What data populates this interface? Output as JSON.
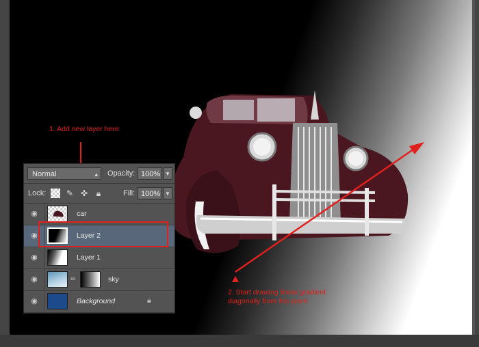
{
  "layers_panel": {
    "blend_mode": "Normal",
    "opacity_label": "Opacity:",
    "opacity_value": "100%",
    "lock_label": "Lock:",
    "fill_label": "Fill:",
    "fill_value": "100%",
    "layers": [
      {
        "name": "car",
        "italic": false,
        "selected": false,
        "thumb": "transparent-car",
        "visible": true
      },
      {
        "name": "Layer 2",
        "italic": false,
        "selected": true,
        "thumb": "black-white-gradient",
        "visible": true
      },
      {
        "name": "Layer 1",
        "italic": false,
        "selected": false,
        "thumb": "white-gradient",
        "visible": true
      },
      {
        "name": "sky",
        "italic": false,
        "selected": false,
        "thumb": "sky-with-mask",
        "visible": true
      },
      {
        "name": "Background",
        "italic": true,
        "selected": false,
        "thumb": "solid-blue",
        "visible": true,
        "locked": true
      }
    ]
  },
  "annotations": {
    "step1": "1. Add new layer here",
    "step2_line1": "2. Start drawing linear gradient",
    "step2_line2": "diagonally from this point"
  },
  "colors": {
    "annotation_red": "#e0201c",
    "panel_bg": "#535353",
    "selected_layer_bg": "#59677a",
    "background_thumb_blue": "#1d4a8a"
  }
}
